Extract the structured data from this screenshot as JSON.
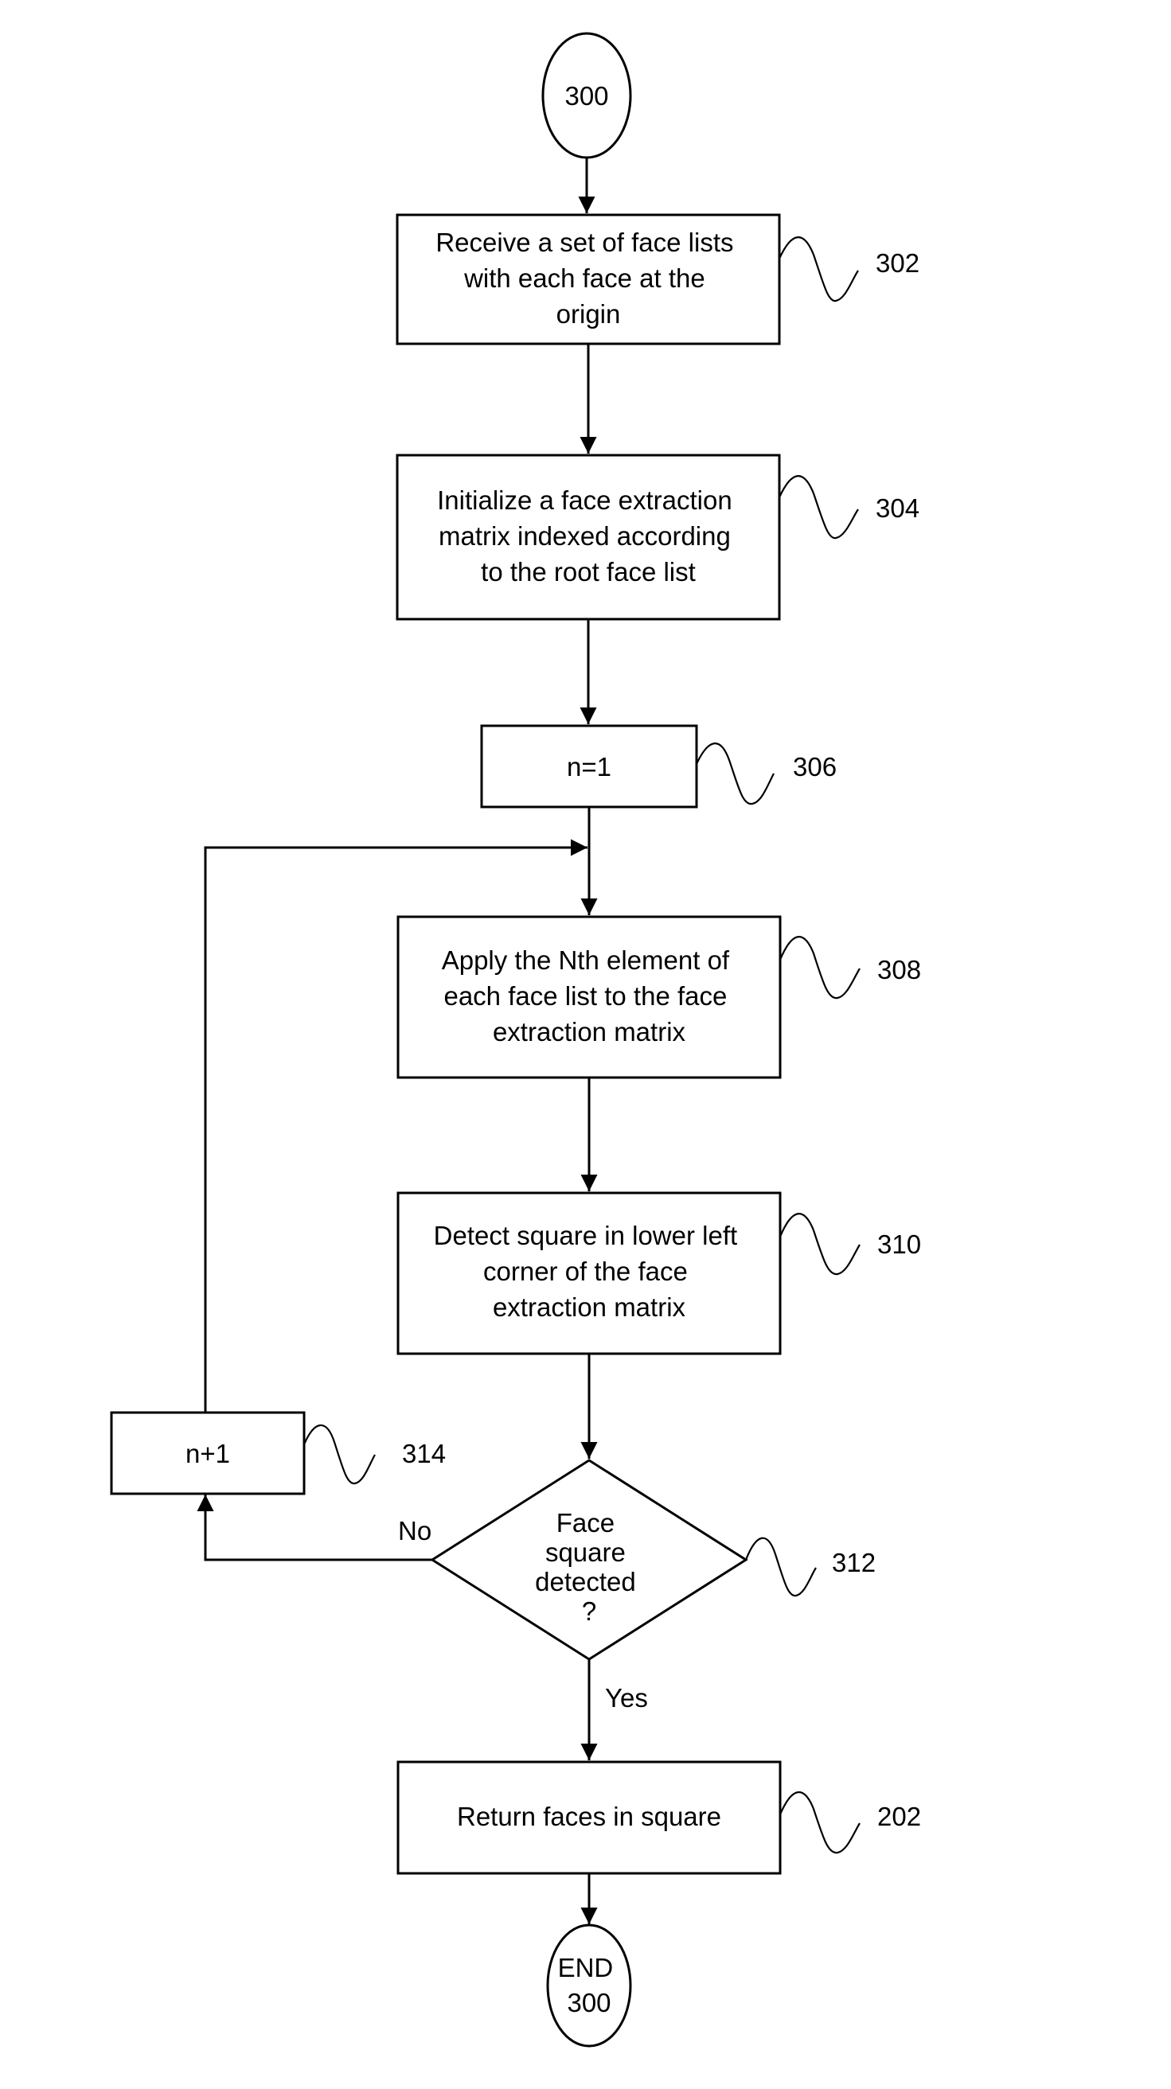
{
  "figure": {
    "start": {
      "label": "300"
    },
    "end": {
      "lines": [
        "END",
        "300"
      ]
    },
    "steps": [
      {
        "id": "302",
        "lines": [
          "Receive a set of face lists",
          "with each face at the",
          "origin"
        ]
      },
      {
        "id": "304",
        "lines": [
          "Initialize a face extraction",
          "matrix indexed according",
          "to the root face list"
        ]
      },
      {
        "id": "306",
        "lines": [
          "n=1"
        ]
      },
      {
        "id": "308",
        "lines": [
          "Apply the Nth element of",
          "each face list to the face",
          "extraction matrix"
        ]
      },
      {
        "id": "310",
        "lines": [
          "Detect square in lower left",
          "corner of the face",
          "extraction matrix"
        ]
      },
      {
        "id": "314",
        "lines": [
          "n+1"
        ]
      },
      {
        "id": "202",
        "lines": [
          "Return faces in square"
        ]
      }
    ],
    "decision": {
      "id": "312",
      "lines": [
        "Face",
        "square",
        "detected",
        "?"
      ],
      "yes_label": "Yes",
      "no_label": "No"
    }
  }
}
